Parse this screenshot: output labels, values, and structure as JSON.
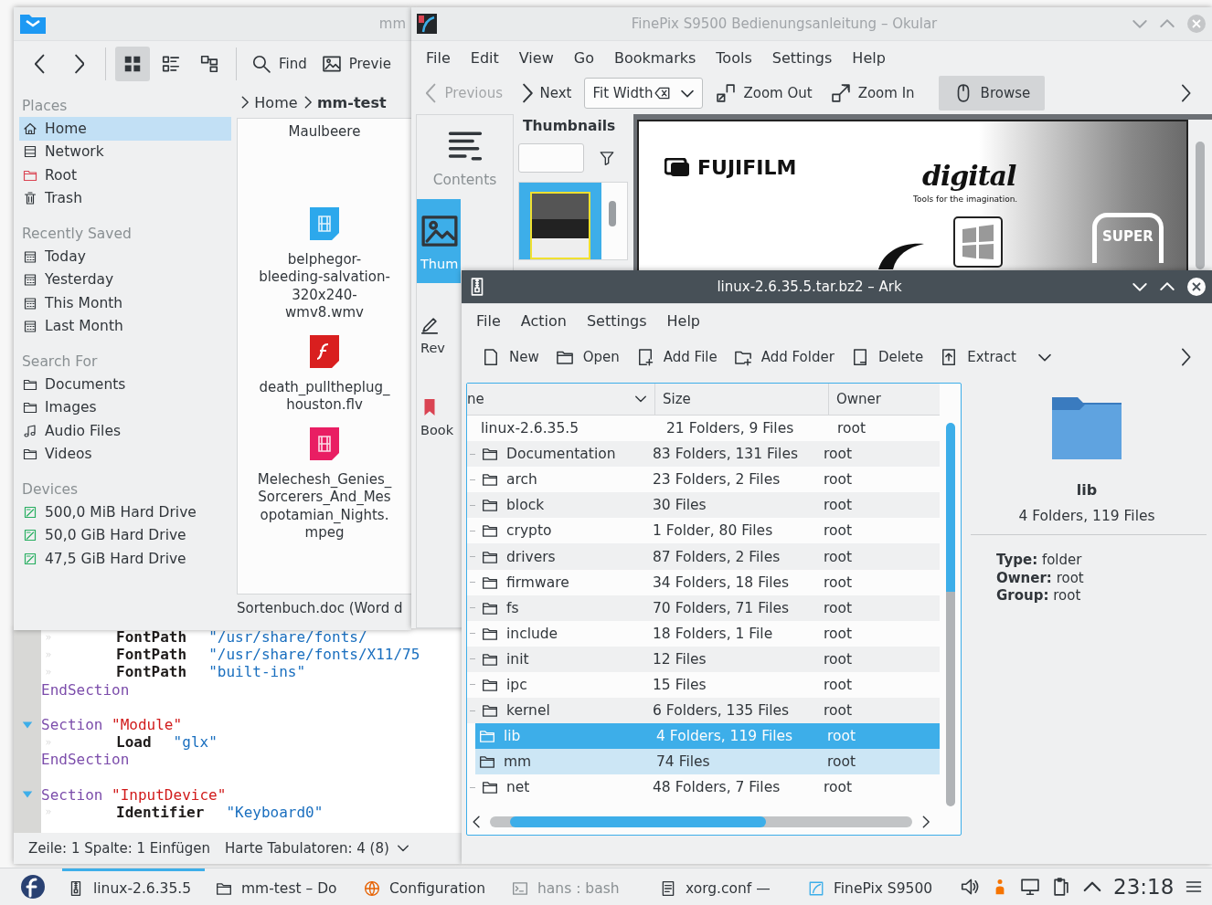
{
  "dolphin": {
    "title": "mm",
    "active": false,
    "view_modes": [
      {
        "kind": "icons",
        "selected": true
      },
      {
        "kind": "details",
        "selected": false
      },
      {
        "kind": "columns",
        "selected": false
      }
    ],
    "buttons": [
      {
        "kind": "search",
        "label": "Find"
      },
      {
        "kind": "image",
        "label": "Previe"
      }
    ],
    "places": [
      {
        "heading": "Places",
        "items": [
          {
            "kind": "home",
            "label": "Home",
            "selected": true
          },
          {
            "kind": "network",
            "label": "Network",
            "selected": false
          },
          {
            "kind": "root",
            "label": "Root",
            "selected": false
          },
          {
            "kind": "trash",
            "label": "Trash",
            "selected": false
          }
        ]
      },
      {
        "heading": "Recently Saved",
        "items": [
          {
            "kind": "calendar",
            "label": "Today",
            "selected": false
          },
          {
            "kind": "calendar",
            "label": "Yesterday",
            "selected": false
          },
          {
            "kind": "calendar",
            "label": "This Month",
            "selected": false
          },
          {
            "kind": "calendar",
            "label": "Last Month",
            "selected": false
          }
        ]
      },
      {
        "heading": "Search For",
        "items": [
          {
            "kind": "folder",
            "label": "Documents",
            "selected": false
          },
          {
            "kind": "folder",
            "label": "Images",
            "selected": false
          },
          {
            "kind": "music",
            "label": "Audio Files",
            "selected": false
          },
          {
            "kind": "folder",
            "label": "Videos",
            "selected": false
          }
        ]
      },
      {
        "heading": "Devices",
        "items": [
          {
            "kind": "drive",
            "label": "500,0 MiB Hard Drive",
            "selected": false
          },
          {
            "kind": "drive",
            "label": "50,0 GiB Hard Drive",
            "selected": false
          },
          {
            "kind": "drive",
            "label": "47,5 GiB Hard Drive",
            "selected": false
          }
        ]
      }
    ],
    "breadcrumb": [
      "Home",
      "mm-test"
    ],
    "files": [
      {
        "name": "Maulbeere"
      },
      {
        "name": "belphegor-bleeding-salvation-320x240-wmv8.wmv",
        "kind": "video",
        "color": "#2ca8ec"
      },
      {
        "name": "death_pulltheplug_houston.flv",
        "kind": "flash",
        "color": "#d91f1f"
      },
      {
        "name": "Melechesh_Genies_Sorcerers_And_Mesopotamian_Nights.mpeg",
        "kind": "video",
        "color": "#e91e63"
      }
    ],
    "status": "Sortenbuch.doc (Word d"
  },
  "okular": {
    "title": "FinePix S9500 Bedienungsanleitung – Okular",
    "active": false,
    "menu": [
      "File",
      "Edit",
      "View",
      "Go",
      "Bookmarks",
      "Tools",
      "Settings",
      "Help"
    ],
    "toolbar": [
      {
        "kind": "previous",
        "label": "Previous",
        "disabled": true,
        "checked": false
      },
      {
        "kind": "next",
        "label": "Next",
        "disabled": false,
        "checked": false
      },
      {
        "kind": "combo",
        "label": "Fit Width",
        "disabled": false,
        "checked": false
      },
      {
        "kind": "zoom-out",
        "label": "Zoom Out",
        "disabled": false,
        "checked": false
      },
      {
        "kind": "zoom-in",
        "label": "Zoom In",
        "disabled": false,
        "checked": false
      },
      {
        "kind": "browse",
        "label": "Browse",
        "disabled": false,
        "checked": true
      }
    ],
    "side_tabs": [
      {
        "kind": "contents",
        "label": "Contents",
        "selected": false
      },
      {
        "kind": "thumbnails",
        "label": "Thum",
        "selected": true
      },
      {
        "kind": "review",
        "label": "Rev",
        "selected": false
      },
      {
        "kind": "bookmarks",
        "label": "Book",
        "selected": false
      }
    ],
    "thumbnails_title": "Thumbnails",
    "page": {
      "brand": "FUJIFILM",
      "logo": "digital",
      "tagline": "Tools for the imagination.",
      "badge": "SUPER"
    }
  },
  "kate": {
    "lines": [
      {
        "kind": "code",
        "indent": true,
        "tokens": [
          {
            "kind": "option",
            "text": "FontPath"
          },
          {
            "kind": "string",
            "text": "\"/usr/share/fonts/"
          }
        ]
      },
      {
        "kind": "code",
        "indent": true,
        "tokens": [
          {
            "kind": "option",
            "text": "FontPath"
          },
          {
            "kind": "string",
            "text": "\"/usr/share/fonts/X11/75"
          }
        ]
      },
      {
        "kind": "code",
        "indent": true,
        "tokens": [
          {
            "kind": "option",
            "text": "FontPath"
          },
          {
            "kind": "string",
            "text": "\"built-ins\""
          }
        ]
      },
      {
        "kind": "code",
        "indent": false,
        "tokens": [
          {
            "kind": "keyword",
            "text": "EndSection"
          }
        ]
      },
      {
        "kind": "blank"
      },
      {
        "kind": "fold",
        "indent": false,
        "tokens": [
          {
            "kind": "keyword",
            "text": "Section"
          },
          {
            "kind": "name",
            "text": "\"Module\""
          }
        ]
      },
      {
        "kind": "code",
        "indent": true,
        "tokens": [
          {
            "kind": "option",
            "text": "Load"
          },
          {
            "kind": "string",
            "text": "\"glx\""
          }
        ]
      },
      {
        "kind": "code",
        "indent": false,
        "tokens": [
          {
            "kind": "keyword",
            "text": "EndSection"
          }
        ]
      },
      {
        "kind": "blank"
      },
      {
        "kind": "fold",
        "indent": false,
        "tokens": [
          {
            "kind": "keyword",
            "text": "Section"
          },
          {
            "kind": "name",
            "text": "\"InputDevice\""
          }
        ]
      },
      {
        "kind": "code",
        "indent": true,
        "tokens": [
          {
            "kind": "option",
            "text": "Identifier"
          },
          {
            "kind": "string",
            "text": "\"Keyboard0\""
          }
        ]
      }
    ],
    "status": {
      "position": "Zeile: 1 Spalte: 1 Einfügen",
      "tabs": "Harte Tabulatoren: 4 (8)"
    }
  },
  "ark": {
    "title": "linux-2.6.35.5.tar.bz2 – Ark",
    "active": true,
    "menu": [
      "File",
      "Action",
      "Settings",
      "Help"
    ],
    "toolbar": [
      {
        "kind": "new",
        "label": "New"
      },
      {
        "kind": "open",
        "label": "Open"
      },
      {
        "kind": "add-file",
        "label": "Add File"
      },
      {
        "kind": "add-folder",
        "label": "Add Folder"
      },
      {
        "kind": "delete",
        "label": "Delete"
      },
      {
        "kind": "extract",
        "label": "Extract"
      }
    ],
    "columns": [
      "ne",
      "Size",
      "Owner"
    ],
    "rows": [
      {
        "name": "linux-2.6.35.5",
        "size": "21 Folders, 9 Files",
        "owner": "root",
        "selected": false,
        "hovered": false,
        "children": [
          {
            "name": "Documentation",
            "size": "83 Folders, 131 Files",
            "owner": "root",
            "selected": false,
            "hovered": false
          },
          {
            "name": "arch",
            "size": "23 Folders, 2 Files",
            "owner": "root",
            "selected": false,
            "hovered": false
          },
          {
            "name": "block",
            "size": "30 Files",
            "owner": "root",
            "selected": false,
            "hovered": false
          },
          {
            "name": "crypto",
            "size": "1 Folder, 80 Files",
            "owner": "root",
            "selected": false,
            "hovered": false
          },
          {
            "name": "drivers",
            "size": "87 Folders, 2 Files",
            "owner": "root",
            "selected": false,
            "hovered": false
          },
          {
            "name": "firmware",
            "size": "34 Folders, 18 Files",
            "owner": "root",
            "selected": false,
            "hovered": false
          },
          {
            "name": "fs",
            "size": "70 Folders, 71 Files",
            "owner": "root",
            "selected": false,
            "hovered": false
          },
          {
            "name": "include",
            "size": "18 Folders, 1 File",
            "owner": "root",
            "selected": false,
            "hovered": false
          },
          {
            "name": "init",
            "size": "12 Files",
            "owner": "root",
            "selected": false,
            "hovered": false
          },
          {
            "name": "ipc",
            "size": "15 Files",
            "owner": "root",
            "selected": false,
            "hovered": false
          },
          {
            "name": "kernel",
            "size": "6 Folders, 135 Files",
            "owner": "root",
            "selected": false,
            "hovered": false
          },
          {
            "name": "lib",
            "size": "4 Folders, 119 Files",
            "owner": "root",
            "selected": true,
            "hovered": false
          },
          {
            "name": "mm",
            "size": "74 Files",
            "owner": "root",
            "selected": false,
            "hovered": true
          },
          {
            "name": "net",
            "size": "48 Folders, 7 Files",
            "owner": "root",
            "selected": false,
            "hovered": false
          }
        ]
      }
    ],
    "details": {
      "name": "lib",
      "summary": "4 Folders, 119 Files",
      "properties": [
        "**Type:** folder",
        "**Owner:** root",
        "**Group:** root"
      ]
    }
  },
  "taskbar": {
    "tasks": [
      {
        "kind": "archive",
        "label": "linux-2.6.35.5",
        "active": true,
        "dimmed": false
      },
      {
        "kind": "folder",
        "label": "mm-test – Do",
        "active": false,
        "dimmed": false
      },
      {
        "kind": "globe",
        "label": "Configuration",
        "active": false,
        "dimmed": false
      },
      {
        "kind": "terminal",
        "label": "hans : bash",
        "active": false,
        "dimmed": true
      },
      {
        "kind": "doc",
        "label": "xorg.conf —",
        "active": false,
        "dimmed": false
      },
      {
        "kind": "viewer",
        "label": "FinePix S9500",
        "active": false,
        "dimmed": false
      }
    ],
    "clock": "23:18"
  }
}
